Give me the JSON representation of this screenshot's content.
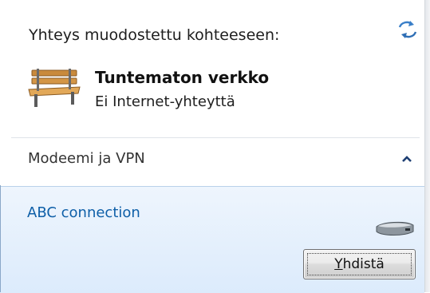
{
  "header": {
    "connected_to_label": "Yhteys muodostettu kohteeseen:",
    "refresh_icon": "refresh-arrows-icon"
  },
  "current_network": {
    "icon": "bench-icon",
    "name": "Tuntematon verkko",
    "status": "Ei Internet-yhteyttä"
  },
  "section": {
    "label": "Modeemi ja VPN",
    "chevron_icon": "chevron-up-icon"
  },
  "connections": [
    {
      "name": "ABC connection",
      "icon": "modem-icon",
      "button_accel": "Y",
      "button_rest": "hdistä"
    }
  ],
  "colors": {
    "link_blue": "#0e5fa8",
    "selected_bg_top": "#eef5fd",
    "selected_bg_bottom": "#dcebfc"
  }
}
